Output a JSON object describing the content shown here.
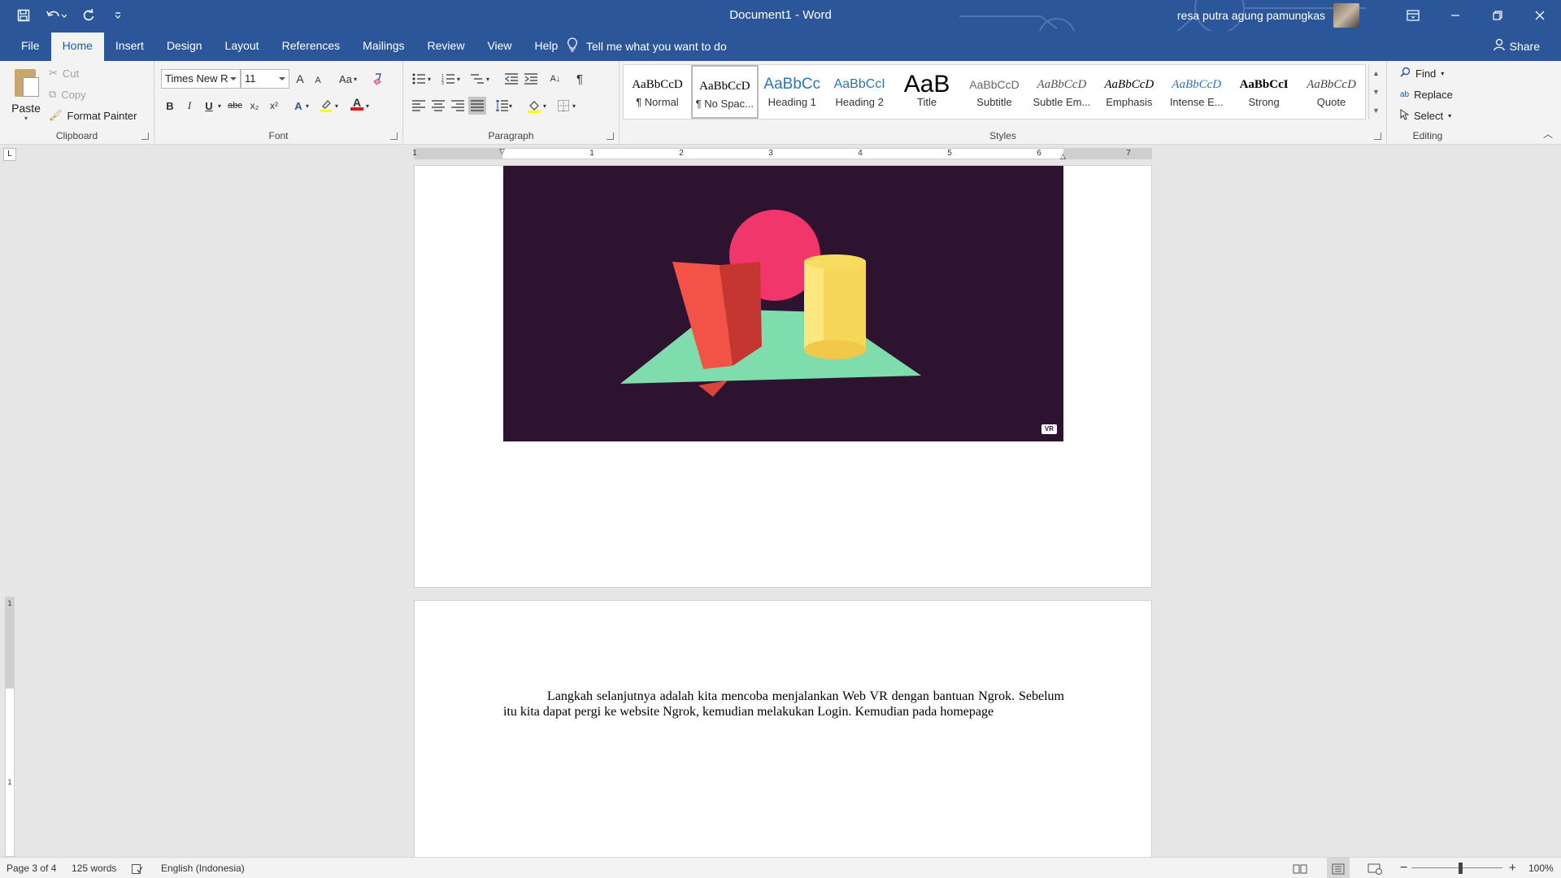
{
  "titlebar": {
    "title": "Document1  -  Word",
    "user_name": "resa putra agung pamungkas",
    "qat_icons": [
      "save-icon",
      "undo-icon",
      "redo-icon",
      "customize-qat-icon"
    ],
    "window_controls": [
      "ribbon-display-icon",
      "minimize-icon",
      "restore-icon",
      "close-icon"
    ]
  },
  "tabs": [
    "File",
    "Home",
    "Insert",
    "Design",
    "Layout",
    "References",
    "Mailings",
    "Review",
    "View",
    "Help"
  ],
  "active_tab": "Home",
  "tell_me": "Tell me what you want to do",
  "share": "Share",
  "clipboard": {
    "label": "Clipboard",
    "paste": "Paste",
    "cut": "Cut",
    "copy": "Copy",
    "format_painter": "Format Painter"
  },
  "font": {
    "label": "Font",
    "name": "Times New R",
    "size": "11",
    "change_case": "Aa",
    "bold": "B",
    "italic": "I",
    "underline": "U",
    "strikethrough": "abc",
    "subscript": "x₂",
    "superscript": "x²",
    "grow": "A",
    "shrink": "A",
    "font_color": "#e81123",
    "highlight_color": "#ffff00"
  },
  "paragraph": {
    "label": "Paragraph",
    "pilcrow": "¶"
  },
  "styles": {
    "label": "Styles",
    "items": [
      {
        "preview": "AaBbCcD",
        "name": "¶ Normal"
      },
      {
        "preview": "AaBbCcD",
        "name": "¶ No Spac..."
      },
      {
        "preview": "AaBbCc",
        "name": "Heading 1"
      },
      {
        "preview": "AaBbCcI",
        "name": "Heading 2"
      },
      {
        "preview": "AaB",
        "name": "Title"
      },
      {
        "preview": "AaBbCcD",
        "name": "Subtitle"
      },
      {
        "preview": "AaBbCcD",
        "name": "Subtle Em..."
      },
      {
        "preview": "AaBbCcD",
        "name": "Emphasis"
      },
      {
        "preview": "AaBbCcD",
        "name": "Intense E..."
      },
      {
        "preview": "AaBbCcI",
        "name": "Strong"
      },
      {
        "preview": "AaBbCcD",
        "name": "Quote"
      }
    ]
  },
  "editing": {
    "label": "Editing",
    "find": "Find",
    "replace": "Replace",
    "select": "Select"
  },
  "ruler": {
    "numbers": [
      "1",
      "1",
      "2",
      "3",
      "4",
      "5",
      "6",
      "7"
    ],
    "tab_selector": "L"
  },
  "document": {
    "image_badge": "VR",
    "paragraph_text": "Langkah selanjutnya adalah kita mencoba menjalankan Web VR dengan bantuan Ngrok. Sebelum itu kita dapat pergi ke website Ngrok, kemudian melakukan Login. Kemudian pada homepage"
  },
  "status": {
    "page": "Page 3 of 4",
    "words": "125 words",
    "language": "English (Indonesia)",
    "zoom": "100%",
    "zoom_minus": "−",
    "zoom_plus": "+"
  }
}
